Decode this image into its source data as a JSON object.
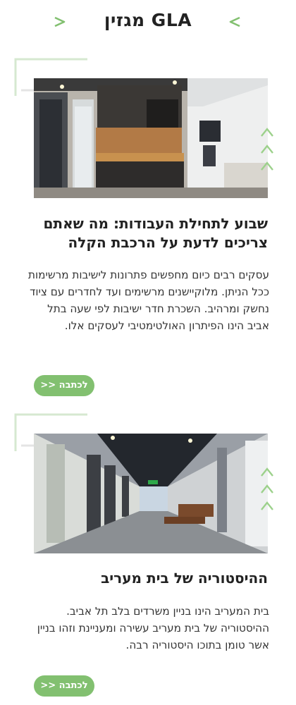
{
  "header": {
    "title": "GLA מגזין",
    "left_arrow_icon": "chevron-right-icon",
    "right_arrow_icon": "chevron-left-icon",
    "accent_color": "#82c070"
  },
  "articles": [
    {
      "image_icon": "office-kitchen-photo",
      "title": "שבוע לתחילת העבודות: מה שאתם צריכים לדעת על הרכבת הקלה",
      "excerpt": "עסקים רבים כיום מחפשים פתרונות לישיבות מרשימות ככל הניתן. מלוקיישנים מרשימים ועד לחדרים עם ציוד נחשק ומרהיב. השכרת חדר ישיבות לפי שעה בתל אביב הינו הפיתרון האולטימטיבי לעסקים אלו.",
      "button_label": "לכתבה <<"
    },
    {
      "image_icon": "office-corridor-photo",
      "title": "ההיסטוריה של בית מעריב",
      "excerpt": "בית המעריב הינו בניין משרדים בלב תל אביב. ההיסטוריה של בית מעריב עשירה ומעניינת וזהו בניין אשר טומן בתוכו היסטוריה רבה.",
      "button_label": "לכתבה <<"
    }
  ]
}
